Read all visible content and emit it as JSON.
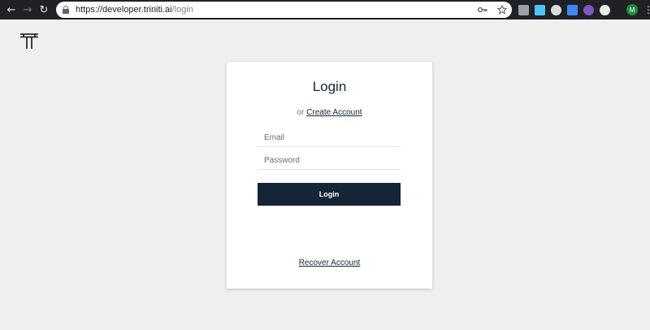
{
  "browser": {
    "url_host": "https://developer.triniti.ai",
    "url_path": "/login",
    "nav": {
      "back": "←",
      "forward": "→",
      "reload": "↻"
    },
    "omnibox_icons": [
      "key-icon",
      "star-icon"
    ],
    "profile_initial": "M",
    "menu": "⋮",
    "extensions": [
      {
        "name": "ext-grid-icon",
        "color": "#9aa0a6"
      },
      {
        "name": "ext-doc-icon",
        "color": "#4fc3f7"
      },
      {
        "name": "ext-circle-icon",
        "color": "#dadce0"
      },
      {
        "name": "ext-translate-icon",
        "color": "#4285f4"
      },
      {
        "name": "ext-play-icon",
        "color": "#7e57c2"
      },
      {
        "name": "ext-record-icon",
        "color": "#e8eaed"
      }
    ]
  },
  "logo": {
    "name": "triniti-logo",
    "color": "#111111"
  },
  "login": {
    "title": "Login",
    "alt_prefix": "or",
    "create_account": "Create Account",
    "email_placeholder": "Email",
    "password_placeholder": "Password",
    "submit_label": "Login",
    "recover_account": "Recover Account"
  },
  "colors": {
    "primary": "#152437",
    "background": "#efefef"
  }
}
